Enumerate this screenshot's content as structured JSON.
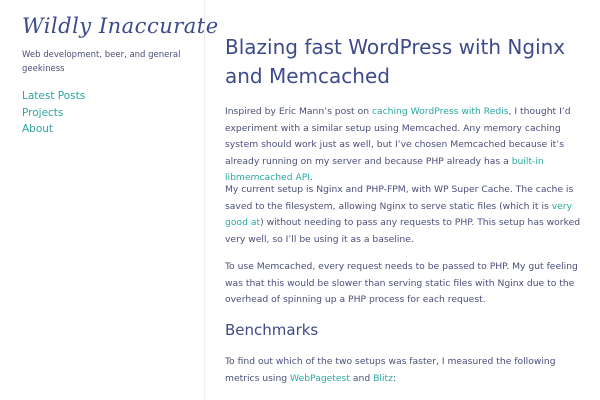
{
  "site": {
    "title": "Wildly Inaccurate",
    "tagline": "Web development, beer, and general geekiness"
  },
  "nav": [
    "Latest Posts",
    "Projects",
    "About"
  ],
  "post": {
    "title": "Blazing fast WordPress with Nginx and Memcached",
    "p1": {
      "t1": "Inspired by Eric Mann’s post on ",
      "l1": "caching WordPress with Redis",
      "t2": ", I thought I’d experiment with a similar setup using Memcached. Any memory caching system should work just as well, but I’ve chosen Memcached because it’s already running on my server and because PHP already has a ",
      "l2": "built-in libmemcached API",
      "t3": "."
    },
    "p2": {
      "t1": "My current setup is Nginx and PHP-FPM, with WP Super Cache. The cache is saved to the filesystem, allowing Nginx to serve static files (which it is ",
      "l1": "very good at",
      "t2": ") without needing to pass any requests to PHP. This setup has worked very well, so I’ll be using it as a baseline."
    },
    "p3": "To use Memcached, every request needs to be passed to PHP. My gut feeling was that this would be slower than serving static files with Nginx due to the overhead of spinning up a PHP process for each request.",
    "h2": "Benchmarks",
    "p4": {
      "t1": "To find out which of the two setups was faster, I measured the following metrics using ",
      "l1": "WebPagetest",
      "t2": " and ",
      "l2": "Blitz",
      "t3": ":"
    }
  },
  "colors": {
    "title": "#3d4b8a",
    "text": "#4a4f7a",
    "link": "#2aa7a0"
  }
}
